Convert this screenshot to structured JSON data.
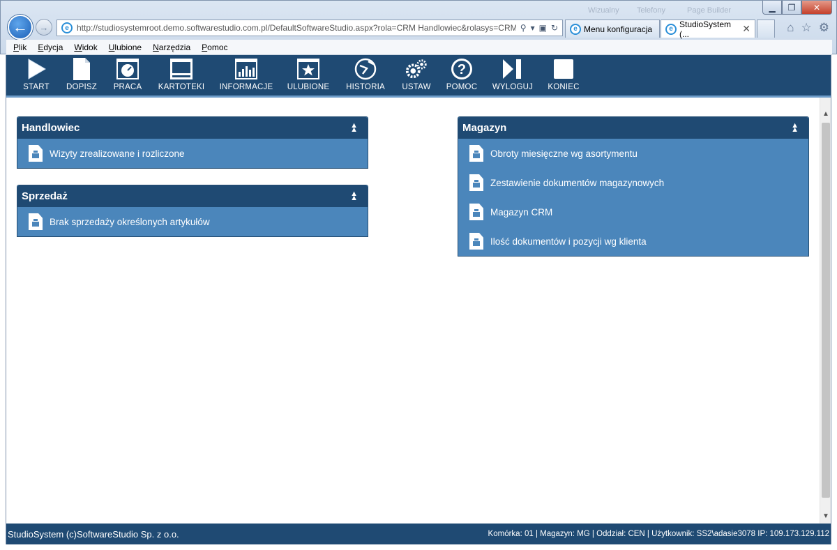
{
  "browser": {
    "address": "http://studiosystemroot.demo.softwarestudio.com.pl/DefaultSoftwareStudio.aspx?rola=CRM Handlowiec&rolasys=CRM",
    "tabs": [
      {
        "label": "Menu konfiguracja"
      },
      {
        "label": "StudioSystem (..."
      }
    ],
    "ghost_toolbars": [
      "Wizualny",
      "Telefony",
      "Page Builder"
    ],
    "menu": [
      "Plik",
      "Edycja",
      "Widok",
      "Ulubione",
      "Narzędzia",
      "Pomoc"
    ]
  },
  "toolbar": {
    "items": [
      {
        "label": "START",
        "icon": "play-icon"
      },
      {
        "label": "DOPISZ",
        "icon": "new-document-icon"
      },
      {
        "label": "PRACA",
        "icon": "gauge-icon"
      },
      {
        "label": "KARTOTEKI",
        "icon": "window-icon"
      },
      {
        "label": "INFORMACJE",
        "icon": "bar-chart-icon"
      },
      {
        "label": "ULUBIONE",
        "icon": "star-icon"
      },
      {
        "label": "HISTORIA",
        "icon": "history-icon"
      },
      {
        "label": "USTAW",
        "icon": "gears-icon"
      },
      {
        "label": "POMOC",
        "icon": "help-icon"
      },
      {
        "label": "WYLOGUJ",
        "icon": "logout-icon"
      },
      {
        "label": "KONIEC",
        "icon": "square-icon"
      }
    ]
  },
  "panels": {
    "handlowiec": {
      "title": "Handlowiec",
      "items": [
        "Wizyty zrealizowane i rozliczone"
      ]
    },
    "sprzedaz": {
      "title": "Sprzedaż",
      "items": [
        "Brak sprzedaży określonych artykułów"
      ]
    },
    "magazyn": {
      "title": "Magazyn",
      "items": [
        "Obroty miesięczne wg asortymentu",
        "Zestawienie dokumentów magazynowych",
        "Magazyn CRM",
        "Ilość dokumentów i pozycji wg klienta"
      ]
    }
  },
  "status": {
    "left": "StudioSystem (c)SoftwareStudio Sp. z o.o.",
    "right": "Komórka: 01 | Magazyn: MG | Oddział: CEN | Użytkownik: SS2\\adasie3078 IP: 109.173.129.112"
  },
  "colors": {
    "header": "#1f4a73",
    "panel": "#4b86bb",
    "accent": "#6d9cc9"
  }
}
